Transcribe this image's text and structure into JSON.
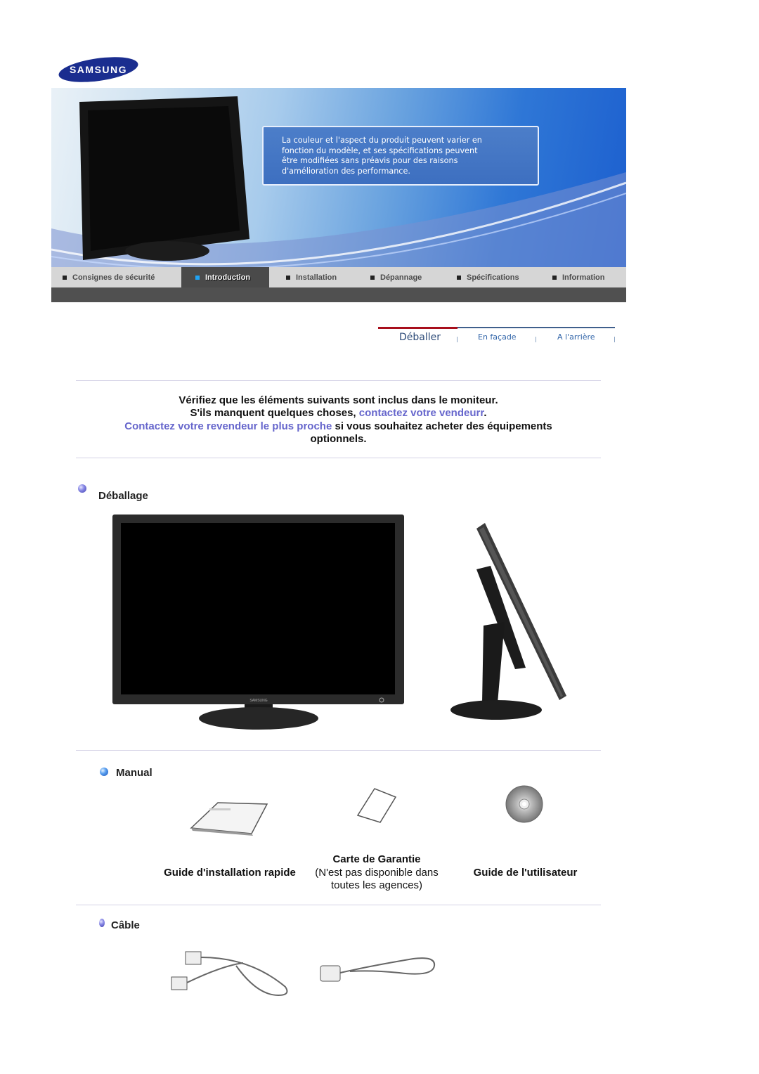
{
  "brand": {
    "logo_text": "SAMSUNG",
    "color": "#1a2d8f"
  },
  "banner": {
    "notice_lines": [
      "La couleur et l'aspect du produit peuvent varier en",
      "fonction du modèle, et ses spécifications peuvent",
      "être modifiées sans préavis pour des raisons",
      "d'amélioration des performance."
    ]
  },
  "nav": {
    "items": [
      {
        "label": "Consignes de sécurité",
        "active": false
      },
      {
        "label": "Introduction",
        "active": true
      },
      {
        "label": "Installation",
        "active": false
      },
      {
        "label": "Dépannage",
        "active": false
      },
      {
        "label": "Spécifications",
        "active": false
      },
      {
        "label": "Information",
        "active": false
      }
    ]
  },
  "subtabs": {
    "items": [
      {
        "label": "Déballer",
        "active": true
      },
      {
        "label": "En façade",
        "active": false
      },
      {
        "label": "A l'arrière",
        "active": false
      }
    ]
  },
  "intro": {
    "line1": "Vérifiez que les éléments suivants sont inclus dans le moniteur.",
    "line2_text": "S'ils manquent quelques choses,",
    "line2_link": "contactez votre vendeurr",
    "line2_end": ".",
    "line3_link": "Contactez votre revendeur le plus proche",
    "line3_text": "si vous souhaitez acheter des équipements",
    "line4": "optionnels."
  },
  "sections": {
    "unpacking": {
      "title": "Déballage",
      "images": [
        "monitor-front",
        "monitor-side"
      ]
    },
    "manual": {
      "title": "Manual",
      "items": [
        {
          "label": "Guide d'installation rapide",
          "note": ""
        },
        {
          "label": "Carte de Garantie",
          "note_line1": "(N'est pas disponible dans",
          "note_line2": "toutes les agences)"
        },
        {
          "label": "Guide de l'utilisateur",
          "note": ""
        }
      ]
    },
    "cable": {
      "title": "Câble",
      "images": [
        "dvi-cable",
        "power-cord"
      ]
    }
  },
  "colors": {
    "link": "#6666cc",
    "nav_active_marker": "#1fa3f5",
    "subtab_active_bar": "#a80f1c"
  }
}
